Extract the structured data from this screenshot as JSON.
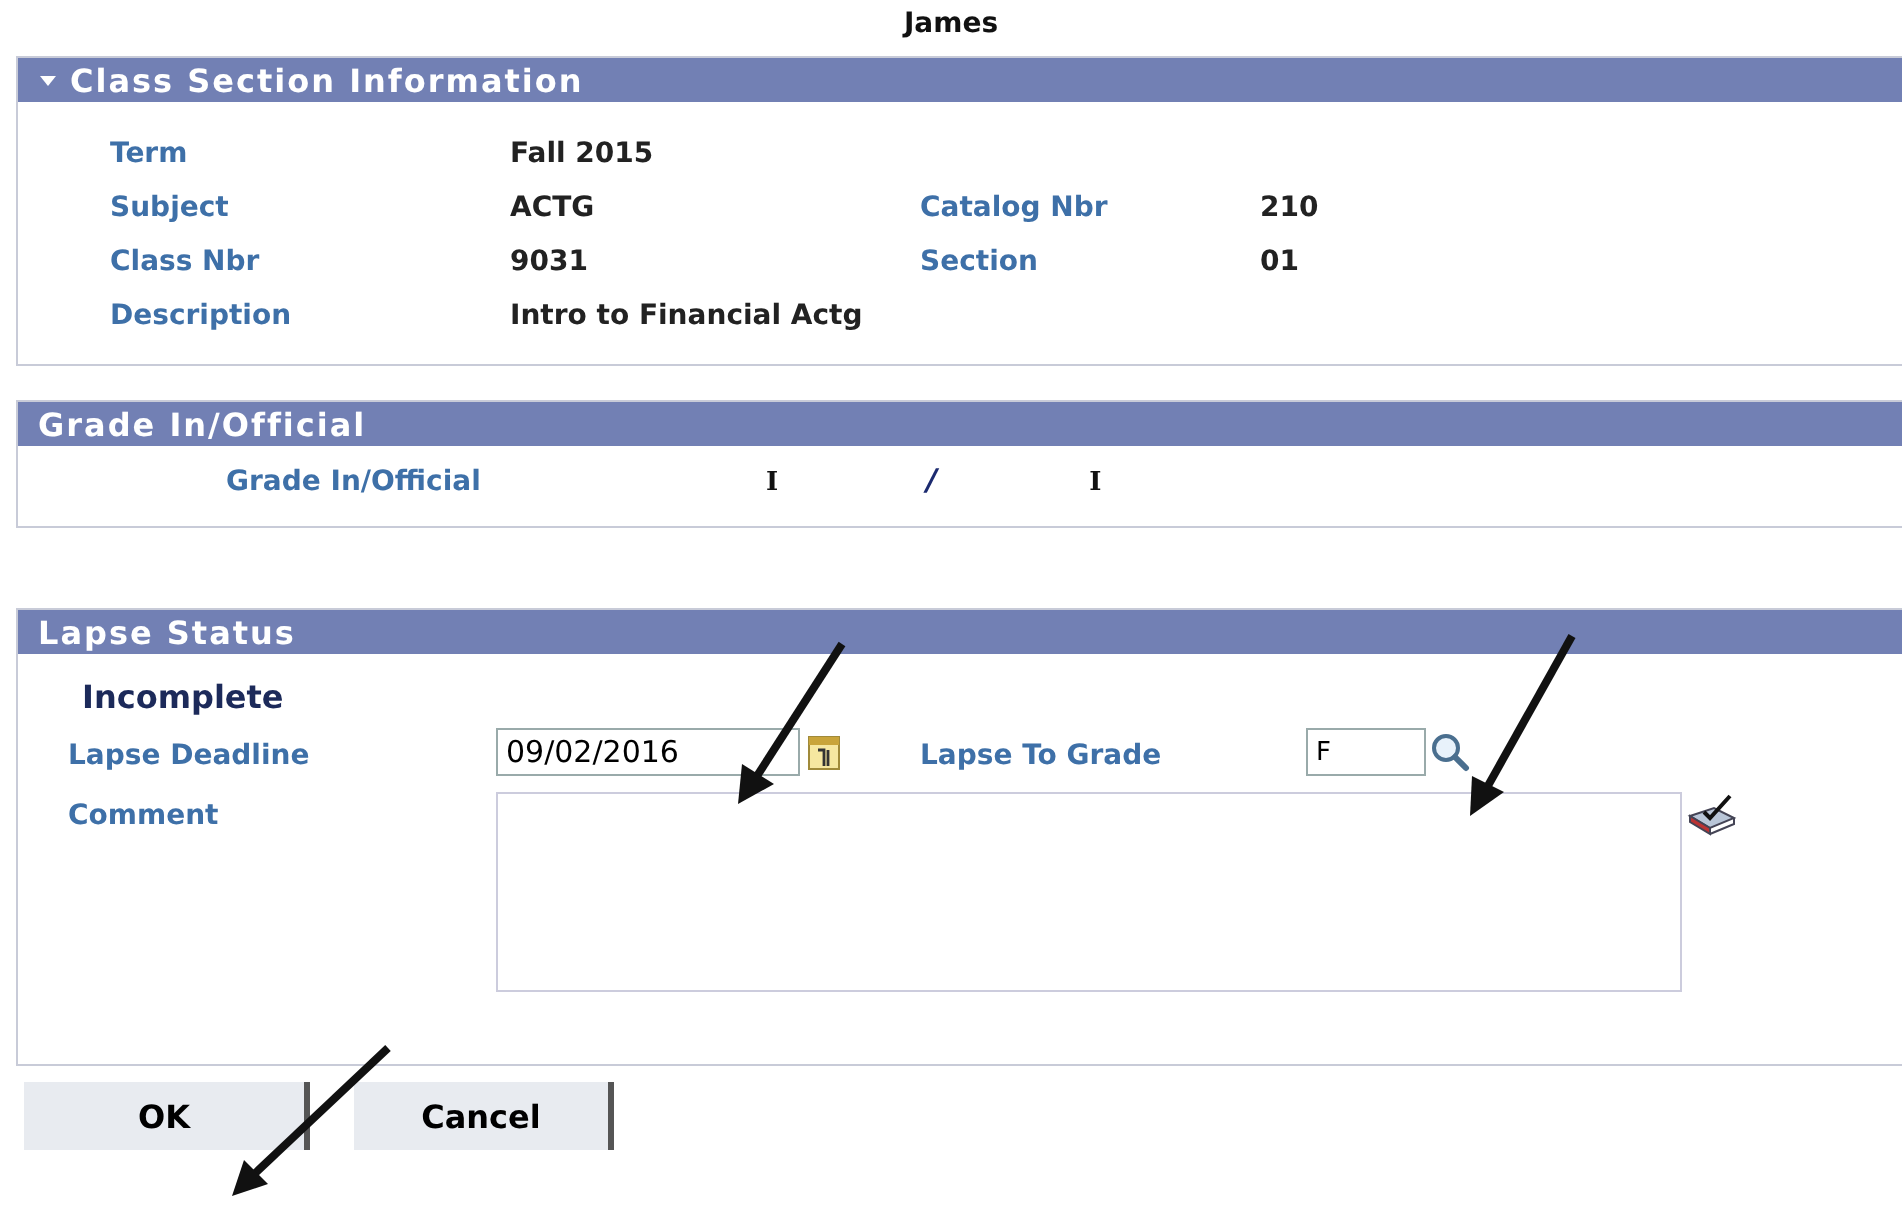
{
  "student_name": "James",
  "class_section": {
    "title": "Class Section Information",
    "expanded": true,
    "term": {
      "label": "Term",
      "value": "Fall 2015"
    },
    "subject": {
      "label": "Subject",
      "value": "ACTG"
    },
    "catalog_nbr": {
      "label": "Catalog Nbr",
      "value": "210"
    },
    "class_nbr": {
      "label": "Class Nbr",
      "value": "9031"
    },
    "section": {
      "label": "Section",
      "value": "01"
    },
    "description": {
      "label": "Description",
      "value": "Intro to Financial Actg"
    }
  },
  "grade": {
    "title": "Grade In/Official",
    "label": "Grade In/Official",
    "grade_in": "I",
    "separator": "/",
    "official": "I"
  },
  "lapse": {
    "title": "Lapse Status",
    "status": "Incomplete",
    "deadline": {
      "label": "Lapse Deadline",
      "value": "09/02/2016"
    },
    "to_grade": {
      "label": "Lapse To Grade",
      "value": "F"
    },
    "comment": {
      "label": "Comment"
    }
  },
  "buttons": [
    "OK",
    "Cancel"
  ]
}
